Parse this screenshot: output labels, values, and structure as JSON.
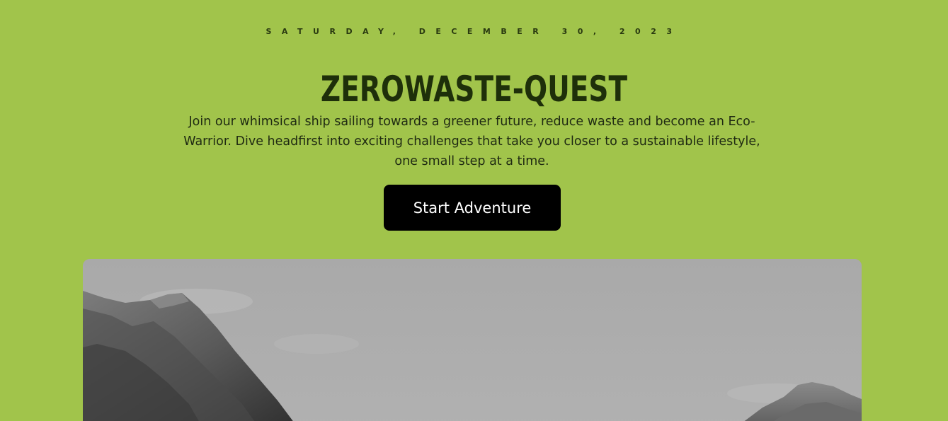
{
  "header": {
    "date": "SATURDAY, DECEMBER 30, 2023",
    "title": "ZEROWASTE-QUEST",
    "intro": "Join our whimsical ship sailing towards a greener future, reduce waste and become an Eco-Warrior. Dive headfirst into exciting challenges that take you closer to a sustainable lifestyle, one small step at a time."
  },
  "cta": {
    "label": "Start Adventure"
  },
  "colors": {
    "background": "#a1c44b",
    "title": "#1e2f0a",
    "button": "#000000",
    "button_text": "#ffffff"
  }
}
